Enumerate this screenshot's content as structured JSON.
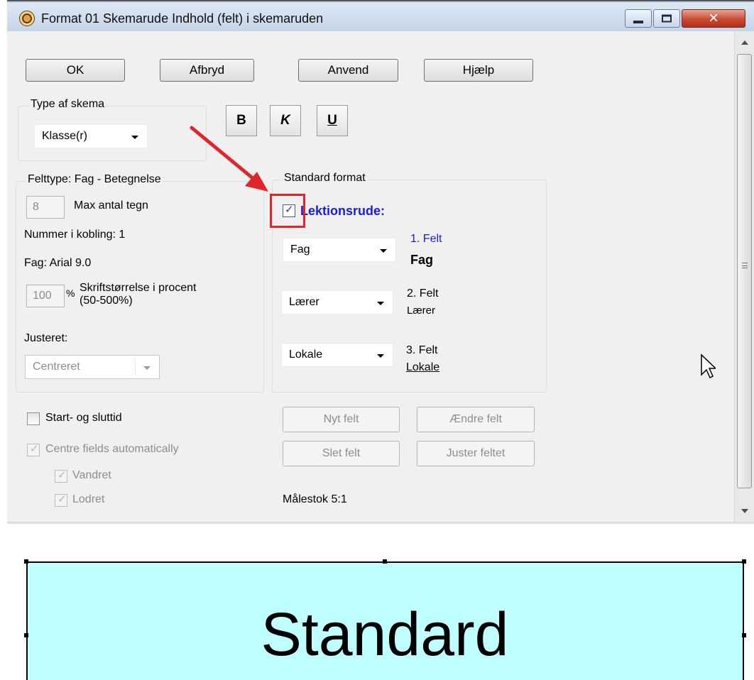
{
  "window": {
    "title": "Format 01  Skemarude  Indhold (felt) i skemaruden",
    "close_glyph": "✕"
  },
  "buttons": {
    "ok": "OK",
    "cancel": "Afbryd",
    "apply": "Anvend",
    "help": "Hjælp"
  },
  "schedule_type": {
    "title": "Type af skema",
    "selected": "Klasse(r)"
  },
  "format_buttons": {
    "bold": "B",
    "italic": "K",
    "underline": "U"
  },
  "field_type": {
    "title": "Felttype: Fag - Betegnelse",
    "max_chars_value": "8",
    "max_chars_label": "Max antal tegn",
    "coupling_number": "Nummer i kobling: 1",
    "font_info": "Fag: Arial 9.0",
    "font_size_value": "100",
    "percent_sign": "%",
    "font_size_label_line1": "Skriftstørrelse i procent",
    "font_size_label_line2": "(50-500%)",
    "alignment_label": "Justeret:",
    "alignment_value": "Centreret"
  },
  "standard_format": {
    "title": "Standard format",
    "lesson_label": "Lektionsrude:",
    "lesson_checked": true,
    "fields": [
      {
        "combo": "Fag",
        "number": "1. Felt",
        "name": "Fag"
      },
      {
        "combo": "Lærer",
        "number": "2. Felt",
        "name": "Lærer"
      },
      {
        "combo": "Lokale",
        "number": "3. Felt",
        "name": "Lokale"
      }
    ]
  },
  "checkboxes": {
    "start_end_time": "Start- og sluttid",
    "centre_fields": "Centre fields automatically",
    "horizontal": "Vandret",
    "vertical": "Lodret",
    "check_glyph": "✓"
  },
  "field_buttons": {
    "new_field": "Nyt felt",
    "change_field": "Ændre felt",
    "delete_field": "Slet felt",
    "adjust_field": "Juster feltet"
  },
  "scale": "Målestok  5:1",
  "preview": {
    "text": "Standard",
    "background": "#bfffff"
  },
  "colors": {
    "accent_blue": "#1a1ae6",
    "annotation_red": "#e0262a"
  }
}
